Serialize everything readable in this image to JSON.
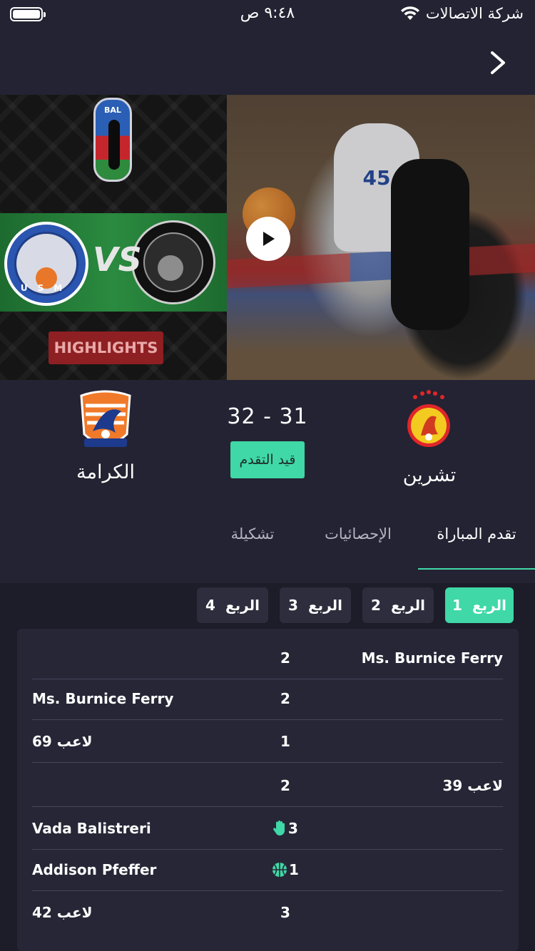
{
  "status_bar": {
    "carrier": "شركة الاتصالات",
    "time": "٩:٤٨ ص"
  },
  "hero": {
    "badge": "HIGHLIGHTS",
    "vs": "VS",
    "bal_text": "BAL",
    "usm_letters": "USM",
    "jersey_number": "45"
  },
  "match": {
    "home_team": "تشرين",
    "away_team": "الكرامة",
    "score": "32 - 31",
    "status": "قيد التقدم"
  },
  "tabs": [
    {
      "label": "تقدم المباراة",
      "active": true
    },
    {
      "label": "الإحصائيات",
      "active": false
    },
    {
      "label": "تشكيلة",
      "active": false
    }
  ],
  "quarters": [
    {
      "word": "الربع",
      "num": "1",
      "active": true
    },
    {
      "word": "الربع",
      "num": "2",
      "active": false
    },
    {
      "word": "الربع",
      "num": "3",
      "active": false
    },
    {
      "word": "الربع",
      "num": "4",
      "active": false
    }
  ],
  "events": [
    {
      "left": "",
      "center": "2",
      "right": "Ms. Burnice Ferry",
      "icon": ""
    },
    {
      "left": "Ms. Burnice Ferry",
      "center": "2",
      "right": "",
      "icon": ""
    },
    {
      "left": "لاعب 69",
      "center": "1",
      "right": "",
      "icon": ""
    },
    {
      "left": "",
      "center": "2",
      "right": "لاعب 39",
      "icon": ""
    },
    {
      "left": "Vada Balistreri",
      "center": "3",
      "right": "",
      "icon": "hand-icon"
    },
    {
      "left": "Addison Pfeffer",
      "center": "1",
      "right": "",
      "icon": "basketball-icon"
    },
    {
      "left": "لاعب 42",
      "center": "3",
      "right": "",
      "icon": ""
    }
  ],
  "colors": {
    "background": "#232333",
    "accent": "#3fd8a6",
    "card": "#262636"
  }
}
